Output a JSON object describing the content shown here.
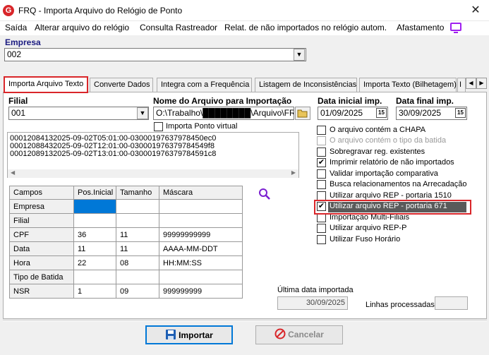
{
  "window": {
    "title": "FRQ - Importa Arquivo do Relógio de Ponto",
    "app_icon": "G",
    "close_glyph": "✕"
  },
  "menu": [
    "Saída",
    "Alterar arquivo do relógio",
    "Consulta Rastreador",
    "Relat. de não importados no relógio autom.",
    "Afastamento"
  ],
  "empresa": {
    "label": "Empresa",
    "value": "002"
  },
  "tabs": [
    "Importa Arquivo Texto",
    "Converte Dados",
    "Integra com a Frequência",
    "Listagem de Inconsistências",
    "Importa Texto (Bilhetagem)",
    "I"
  ],
  "tab_scroll": {
    "left": "◀",
    "right": "▶"
  },
  "filial": {
    "label": "Filial",
    "value": "001"
  },
  "arquivo": {
    "label": "Nome do Arquivo para Importação",
    "value": "O:\\Trabalho\\████████\\Arquivo\\FRQ\\AFD\\"
  },
  "data_inicial": {
    "label": "Data inicial imp.",
    "value": "01/09/2025"
  },
  "data_final": {
    "label": "Data final imp.",
    "value": "30/09/2025"
  },
  "calendar_glyph": "15",
  "importa_ponto_virtual": {
    "label": "Importa Ponto virtual",
    "checked": false
  },
  "log_lines": [
    "00012084132025-09-02T05:01:00-03000197637978450ec0",
    "00012088432025-09-02T12:01:00-030001976379784549f8",
    "00012089132025-09-02T13:01:00-030001976379784591c8"
  ],
  "grid": {
    "headers": [
      "Campos",
      "Pos.Inicial",
      "Tamanho",
      "Máscara"
    ],
    "rows": [
      [
        "Empresa",
        "",
        "",
        ""
      ],
      [
        "Filial",
        "",
        "",
        ""
      ],
      [
        "CPF",
        "36",
        "11",
        "99999999999"
      ],
      [
        "Data",
        "11",
        "11",
        "AAAA-MM-DDT"
      ],
      [
        "Hora",
        "22",
        "08",
        "HH:MM:SS"
      ],
      [
        "Tipo de Batida",
        "",
        "",
        ""
      ],
      [
        "NSR",
        "1",
        "09",
        "999999999"
      ]
    ]
  },
  "options": [
    {
      "label": "O arquivo contém a CHAPA",
      "checked": false,
      "enabled": true
    },
    {
      "label": "O arquivo contém o tipo da batida",
      "checked": false,
      "enabled": false
    },
    {
      "label": "Sobregravar reg. existentes",
      "checked": false,
      "enabled": true
    },
    {
      "label": "Imprimir relatório de não importados",
      "checked": true,
      "enabled": true
    },
    {
      "label": "Validar importação comparativa",
      "checked": false,
      "enabled": true
    },
    {
      "label": "Busca relacionamentos na Arrecadação",
      "checked": false,
      "enabled": true
    },
    {
      "label": "Utilizar arquivo REP - portaria 1510",
      "checked": false,
      "enabled": true
    },
    {
      "label": "Utilizar arquivo REP - portaria 671",
      "checked": true,
      "enabled": true
    },
    {
      "label": "Importação Multi-Filiais",
      "checked": false,
      "enabled": true
    },
    {
      "label": "Utilizar arquivo REP-P",
      "checked": false,
      "enabled": true
    },
    {
      "label": "Utilizar Fuso Horário",
      "checked": false,
      "enabled": true
    }
  ],
  "ultima_data": {
    "label": "Última data importada",
    "value": "30/09/2025"
  },
  "linhas_processadas": {
    "label": "Linhas processadas",
    "value": ""
  },
  "buttons": {
    "importar": "Importar",
    "cancelar": "Cancelar"
  },
  "colors": {
    "accent": "#0078d7",
    "highlight_red": "#d9262a",
    "purple_icon": "#a020f0"
  }
}
